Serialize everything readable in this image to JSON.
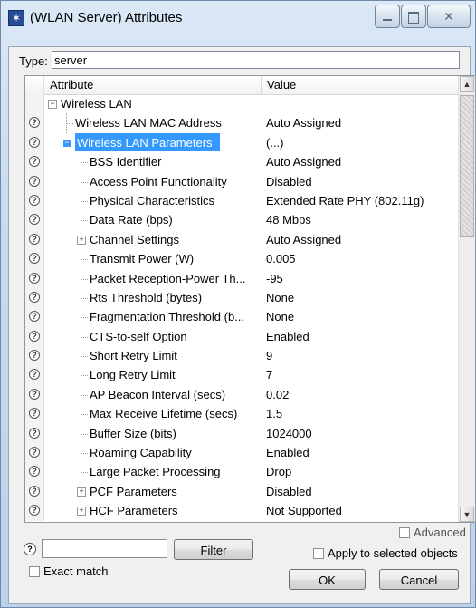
{
  "window": {
    "title": "(WLAN Server) Attributes",
    "close_glyph": "✕"
  },
  "type_field": {
    "label": "Type:",
    "value": "server"
  },
  "table": {
    "headers": {
      "attribute": "Attribute",
      "value": "Value"
    },
    "rows": [
      {
        "attr": "Wireless LAN",
        "value": "",
        "help": false,
        "expander": "⊟",
        "indent": 0,
        "tree": false
      },
      {
        "attr": "Wireless LAN MAC Address",
        "value": "Auto Assigned",
        "help": true,
        "expander": "",
        "indent": 1,
        "tree": true
      },
      {
        "attr": "Wireless LAN Parameters",
        "value": "(...)",
        "help": true,
        "expander": "⊟",
        "indent": 1,
        "tree": false,
        "selected": true
      },
      {
        "attr": "BSS Identifier",
        "value": "Auto Assigned",
        "help": true,
        "expander": "",
        "indent": 2,
        "tree": true
      },
      {
        "attr": "Access Point Functionality",
        "value": "Disabled",
        "help": true,
        "expander": "",
        "indent": 2,
        "tree": true
      },
      {
        "attr": "Physical Characteristics",
        "value": "Extended Rate PHY (802.11g)",
        "help": true,
        "expander": "",
        "indent": 2,
        "tree": true
      },
      {
        "attr": "Data Rate (bps)",
        "value": "48 Mbps",
        "help": true,
        "expander": "",
        "indent": 2,
        "tree": true
      },
      {
        "attr": "Channel Settings",
        "value": "Auto Assigned",
        "help": true,
        "expander": "⊞",
        "indent": 2,
        "tree": false
      },
      {
        "attr": "Transmit Power (W)",
        "value": "0.005",
        "help": true,
        "expander": "",
        "indent": 2,
        "tree": true
      },
      {
        "attr": "Packet Reception-Power Th...",
        "value": "-95",
        "help": true,
        "expander": "",
        "indent": 2,
        "tree": true
      },
      {
        "attr": "Rts Threshold (bytes)",
        "value": "None",
        "help": true,
        "expander": "",
        "indent": 2,
        "tree": true
      },
      {
        "attr": "Fragmentation Threshold (b...",
        "value": "None",
        "help": true,
        "expander": "",
        "indent": 2,
        "tree": true
      },
      {
        "attr": "CTS-to-self Option",
        "value": "Enabled",
        "help": true,
        "expander": "",
        "indent": 2,
        "tree": true
      },
      {
        "attr": "Short Retry Limit",
        "value": "9",
        "help": true,
        "expander": "",
        "indent": 2,
        "tree": true
      },
      {
        "attr": "Long Retry Limit",
        "value": "7",
        "help": true,
        "expander": "",
        "indent": 2,
        "tree": true
      },
      {
        "attr": "AP Beacon Interval (secs)",
        "value": "0.02",
        "help": true,
        "expander": "",
        "indent": 2,
        "tree": true
      },
      {
        "attr": "Max Receive Lifetime (secs)",
        "value": "1.5",
        "help": true,
        "expander": "",
        "indent": 2,
        "tree": true
      },
      {
        "attr": "Buffer Size (bits)",
        "value": "1024000",
        "help": true,
        "expander": "",
        "indent": 2,
        "tree": true
      },
      {
        "attr": "Roaming Capability",
        "value": "Enabled",
        "help": true,
        "expander": "",
        "indent": 2,
        "tree": true
      },
      {
        "attr": "Large Packet Processing",
        "value": "Drop",
        "help": true,
        "expander": "",
        "indent": 2,
        "tree": true
      },
      {
        "attr": "PCF Parameters",
        "value": "Disabled",
        "help": true,
        "expander": "⊞",
        "indent": 2,
        "tree": false
      },
      {
        "attr": "HCF Parameters",
        "value": "Not Supported",
        "help": true,
        "expander": "⊞",
        "indent": 2,
        "tree": false
      }
    ]
  },
  "bottom": {
    "help_glyph": "?",
    "filter_value": "",
    "filter_button": "Filter",
    "exact_match_label": "Exact match",
    "advanced_label": "Advanced",
    "apply_selected_label": "Apply to selected objects",
    "ok_button": "OK",
    "cancel_button": "Cancel"
  }
}
